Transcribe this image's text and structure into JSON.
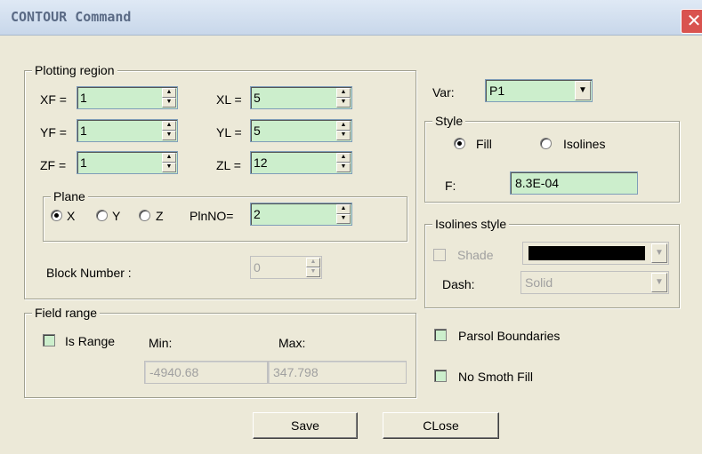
{
  "window": {
    "title": "CONTOUR Command",
    "close_glyph": "✕"
  },
  "plotting_region": {
    "legend": "Plotting region",
    "xf": {
      "label": "XF =",
      "value": "1"
    },
    "yf": {
      "label": "YF =",
      "value": "1"
    },
    "zf": {
      "label": "ZF =",
      "value": "1"
    },
    "xl": {
      "label": "XL =",
      "value": "5"
    },
    "yl": {
      "label": "YL =",
      "value": "5"
    },
    "zl": {
      "label": "ZL =",
      "value": "12"
    },
    "plane": {
      "legend": "Plane",
      "options": [
        "X",
        "Y",
        "Z"
      ],
      "selected": "X",
      "plnno_label": "PlnNO=",
      "plnno_value": "2"
    },
    "block_number": {
      "label": "Block Number :",
      "value": "0"
    }
  },
  "field_range": {
    "legend": "Field range",
    "is_range_label": "Is Range",
    "is_range_checked": false,
    "min_label": "Min:",
    "max_label": "Max:",
    "min_value": "-4940.68",
    "max_value": "347.798"
  },
  "var": {
    "label": "Var:",
    "value": "P1"
  },
  "style": {
    "legend": "Style",
    "fill_label": "Fill",
    "isolines_label": "Isolines",
    "selected": "Fill",
    "f_label": "F:",
    "f_value": "8.3E-04"
  },
  "isolines_style": {
    "legend": "Isolines style",
    "shade_label": "Shade",
    "shade_color": "#000000",
    "dash_label": "Dash:",
    "dash_value": "Solid"
  },
  "options": {
    "parsol_boundaries": "Parsol Boundaries",
    "no_smoth_fill": "No Smoth Fill"
  },
  "buttons": {
    "save": "Save",
    "close": "CLose"
  },
  "colors": {
    "field_bg": "#cceecc",
    "dialog_bg": "#ece9d8",
    "close_bg": "#d9534f"
  }
}
